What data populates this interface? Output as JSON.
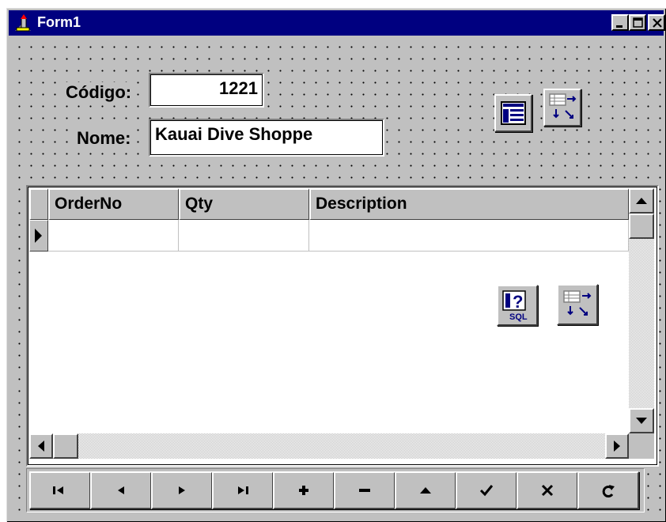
{
  "window": {
    "title": "Form1",
    "icon": "delphi-app-icon",
    "controls": [
      "minimize-icon",
      "maximize-icon",
      "close-icon"
    ]
  },
  "form": {
    "codigo_label": "Código:",
    "codigo_value": "1221",
    "nome_label": "Nome:",
    "nome_value": "Kauai Dive Shoppe"
  },
  "components": [
    "datasource-icon",
    "table-icon",
    "query-sql-icon",
    "table-icon"
  ],
  "grid": {
    "columns": [
      "OrderNo",
      "Qty",
      "Description"
    ],
    "rows": [
      [
        "",
        "",
        ""
      ]
    ]
  },
  "navigator": {
    "buttons": [
      "first-icon",
      "prior-icon",
      "next-icon",
      "last-icon",
      "insert-icon",
      "delete-icon",
      "edit-icon",
      "post-icon",
      "cancel-icon",
      "refresh-icon"
    ]
  },
  "colors": {
    "titlebar": "#000080",
    "face": "#c0c0c0",
    "accent_blue": "#000080"
  }
}
